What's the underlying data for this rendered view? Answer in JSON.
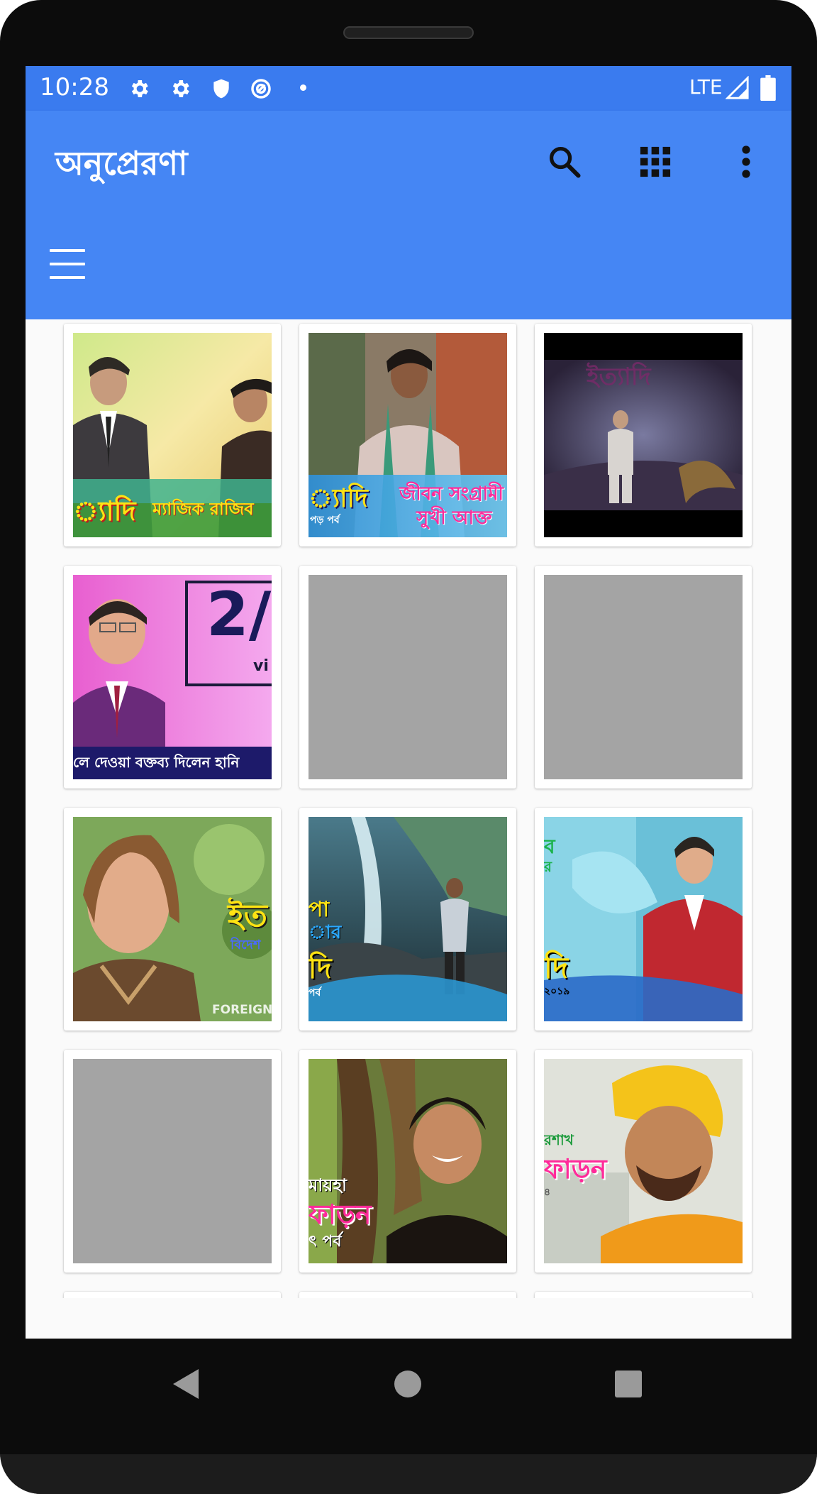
{
  "status_bar": {
    "time": "10:28",
    "network": "LTE",
    "icons": [
      "gear-icon",
      "gear-icon",
      "shield-icon",
      "vpn-icon",
      "notification-dot",
      "signal-icon",
      "battery-icon"
    ]
  },
  "app_bar": {
    "title": "অনুপ্রেরণা",
    "actions": [
      "search-icon",
      "grid-view-icon",
      "more-vert-icon"
    ]
  },
  "toolbar": {
    "menu_icon": "hamburger-menu-icon"
  },
  "grid": {
    "items": [
      {
        "thumb": "loaded",
        "caption_left": "্যাদি",
        "caption_right": "ম্যাজিক রাজিব"
      },
      {
        "thumb": "loaded",
        "caption_left": "্যাদি",
        "caption_sub": "পড় পর্ব",
        "caption_right": "জীবন সংগ্রামী",
        "caption_right2": "সুখী আক্ত"
      },
      {
        "thumb": "loaded",
        "caption_top": "ইত্যাদি"
      },
      {
        "thumb": "loaded",
        "big_text": "2/",
        "small_text": "vi",
        "caption_bottom": "লে দেওয়া বক্তব্য দিলেন হানি"
      },
      {
        "thumb": "placeholder"
      },
      {
        "thumb": "placeholder"
      },
      {
        "thumb": "loaded",
        "caption_right": "ইত",
        "caption_sub": "বিদেশ",
        "caption_bottom": "FOREIGN"
      },
      {
        "thumb": "loaded",
        "caption_left": "পা",
        "caption_left2": "ার",
        "caption_left3": "দি",
        "caption_sub": "পর্ব"
      },
      {
        "thumb": "loaded",
        "caption_left": "ব",
        "caption_left2": "র",
        "caption_left3": "দি",
        "caption_sub": "২০১৯"
      },
      {
        "thumb": "placeholder"
      },
      {
        "thumb": "loaded",
        "caption_left": "মায়হা",
        "caption_left2": "ফাড়ন",
        "caption_sub": "ৎ পর্ব"
      },
      {
        "thumb": "loaded",
        "caption_left": "রশাখ",
        "caption_left2": "ফাড়ন",
        "caption_sub": "৪"
      }
    ]
  },
  "colors": {
    "status_bar": "#3a7bef",
    "app_bar": "#4586f4",
    "grid_background": "#fafafa",
    "placeholder": "#a4a4a4",
    "caption_yellow": "#ffe313",
    "caption_pink": "#ff2a9a"
  },
  "nav_bar": {
    "buttons": [
      "back-icon",
      "home-icon",
      "recents-icon"
    ]
  }
}
